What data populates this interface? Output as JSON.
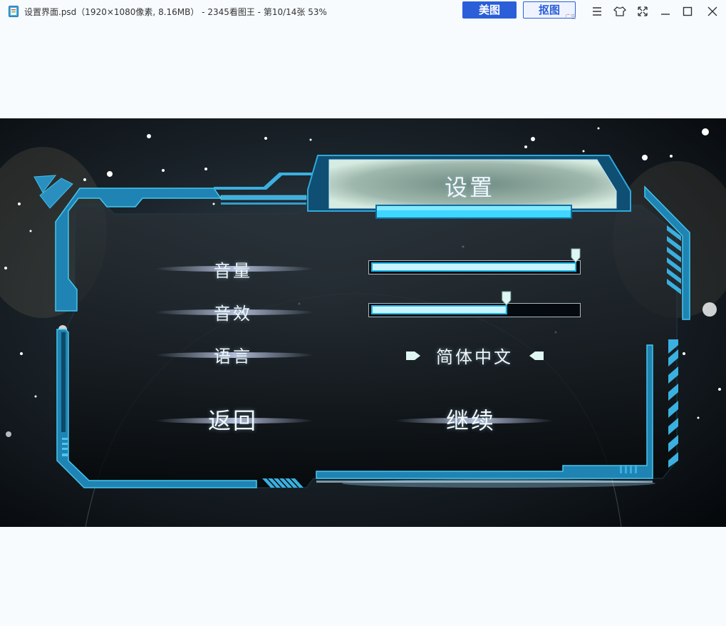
{
  "window": {
    "title": "设置界面.psd（1920×1080像素, 8.16MB） - 2345看图王 - 第10/14张 53%",
    "buttons": {
      "meitu": "美图",
      "koutu": "抠图"
    },
    "ad_label": "广告",
    "controls": [
      "menu-icon",
      "skin-icon",
      "fullscreen-icon",
      "minimize-icon",
      "maximize-icon",
      "close-icon"
    ]
  },
  "settings": {
    "title": "设置",
    "volume": {
      "label": "音量",
      "level": 1.0
    },
    "sound_effects": {
      "label": "音效",
      "level": 0.66
    },
    "language": {
      "label": "语言",
      "value": "简体中文"
    },
    "back_label": "返回",
    "continue_label": "继续"
  },
  "colors": {
    "accent": "#2fb8e8",
    "frame_dark": "#1a5f86",
    "slider_fill": "#c9f4ff",
    "background": "#f7fbfe"
  }
}
